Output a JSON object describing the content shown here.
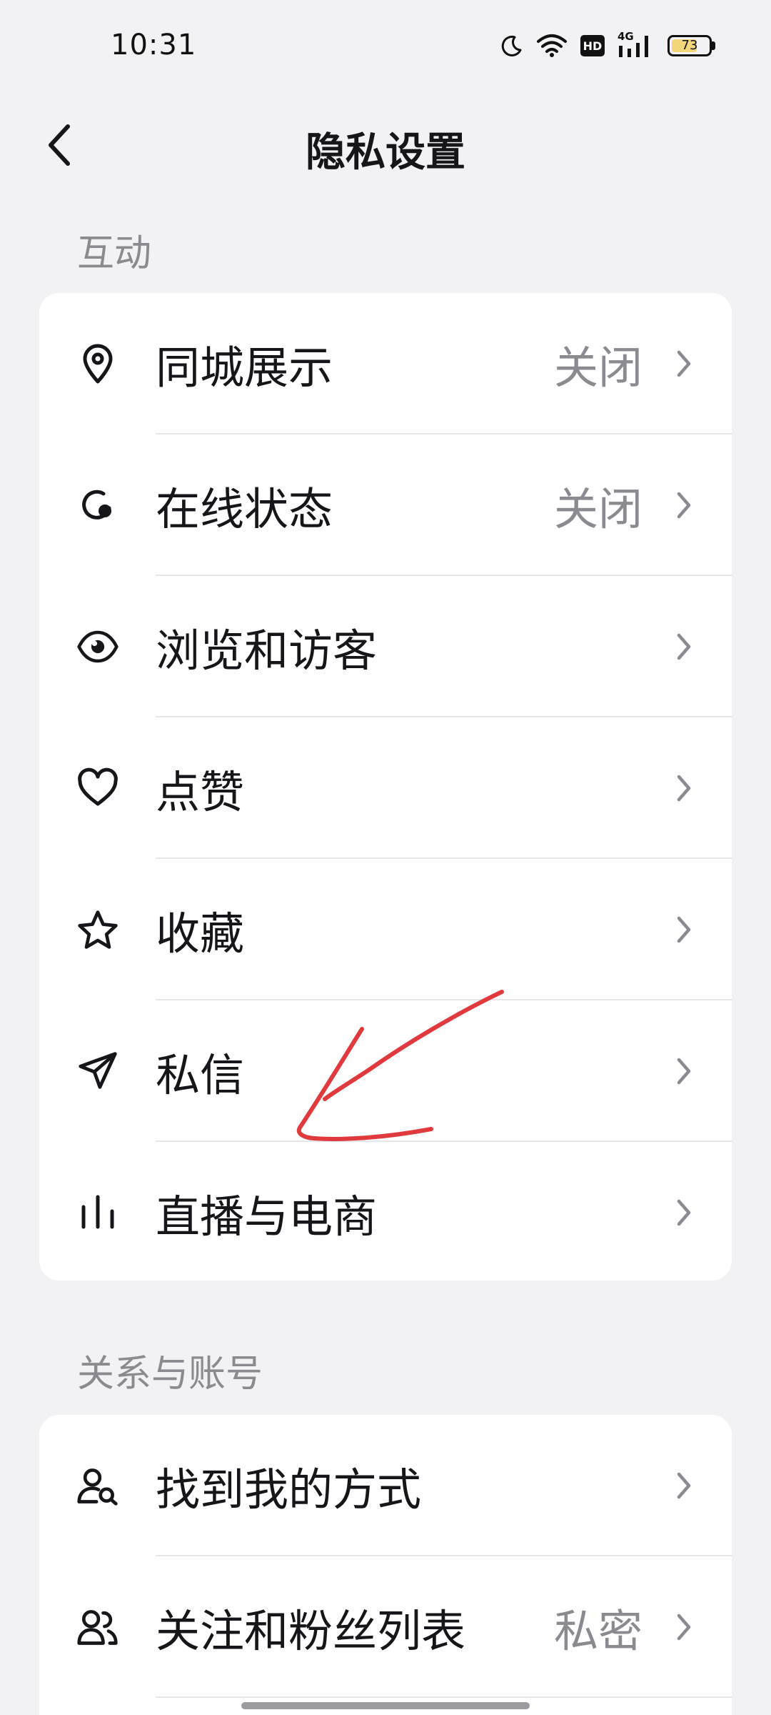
{
  "status_bar": {
    "time": "10:31",
    "network": "4G",
    "hd": "HD",
    "battery": "73",
    "battery_level": 0.73,
    "icons": [
      "moon-icon",
      "wifi-icon",
      "hd-icon",
      "signal-icon",
      "battery-icon"
    ]
  },
  "nav": {
    "title": "隐私设置",
    "back_icon": "chevron-left-icon"
  },
  "sections": [
    {
      "label": "互动",
      "items": [
        {
          "label": "同城展示",
          "value": "关闭",
          "icon": "location-pin-icon"
        },
        {
          "label": "在线状态",
          "value": "关闭",
          "icon": "online-status-icon"
        },
        {
          "label": "浏览和访客",
          "value": "",
          "icon": "eye-icon"
        },
        {
          "label": "点赞",
          "value": "",
          "icon": "heart-icon"
        },
        {
          "label": "收藏",
          "value": "",
          "icon": "star-icon"
        },
        {
          "label": "私信",
          "value": "",
          "icon": "send-icon"
        },
        {
          "label": "直播与电商",
          "value": "",
          "icon": "bars-icon"
        }
      ]
    },
    {
      "label": "关系与账号",
      "items": [
        {
          "label": "找到我的方式",
          "value": "",
          "icon": "user-search-icon"
        },
        {
          "label": "关注和粉丝列表",
          "value": "私密",
          "icon": "users-icon"
        }
      ]
    }
  ],
  "colors": {
    "background": "#f2f2f4",
    "card": "#ffffff",
    "text": "#16161a",
    "secondary_text": "#8a8a90",
    "annotation": "#e0393e",
    "battery_fill": "#f3d57a"
  }
}
